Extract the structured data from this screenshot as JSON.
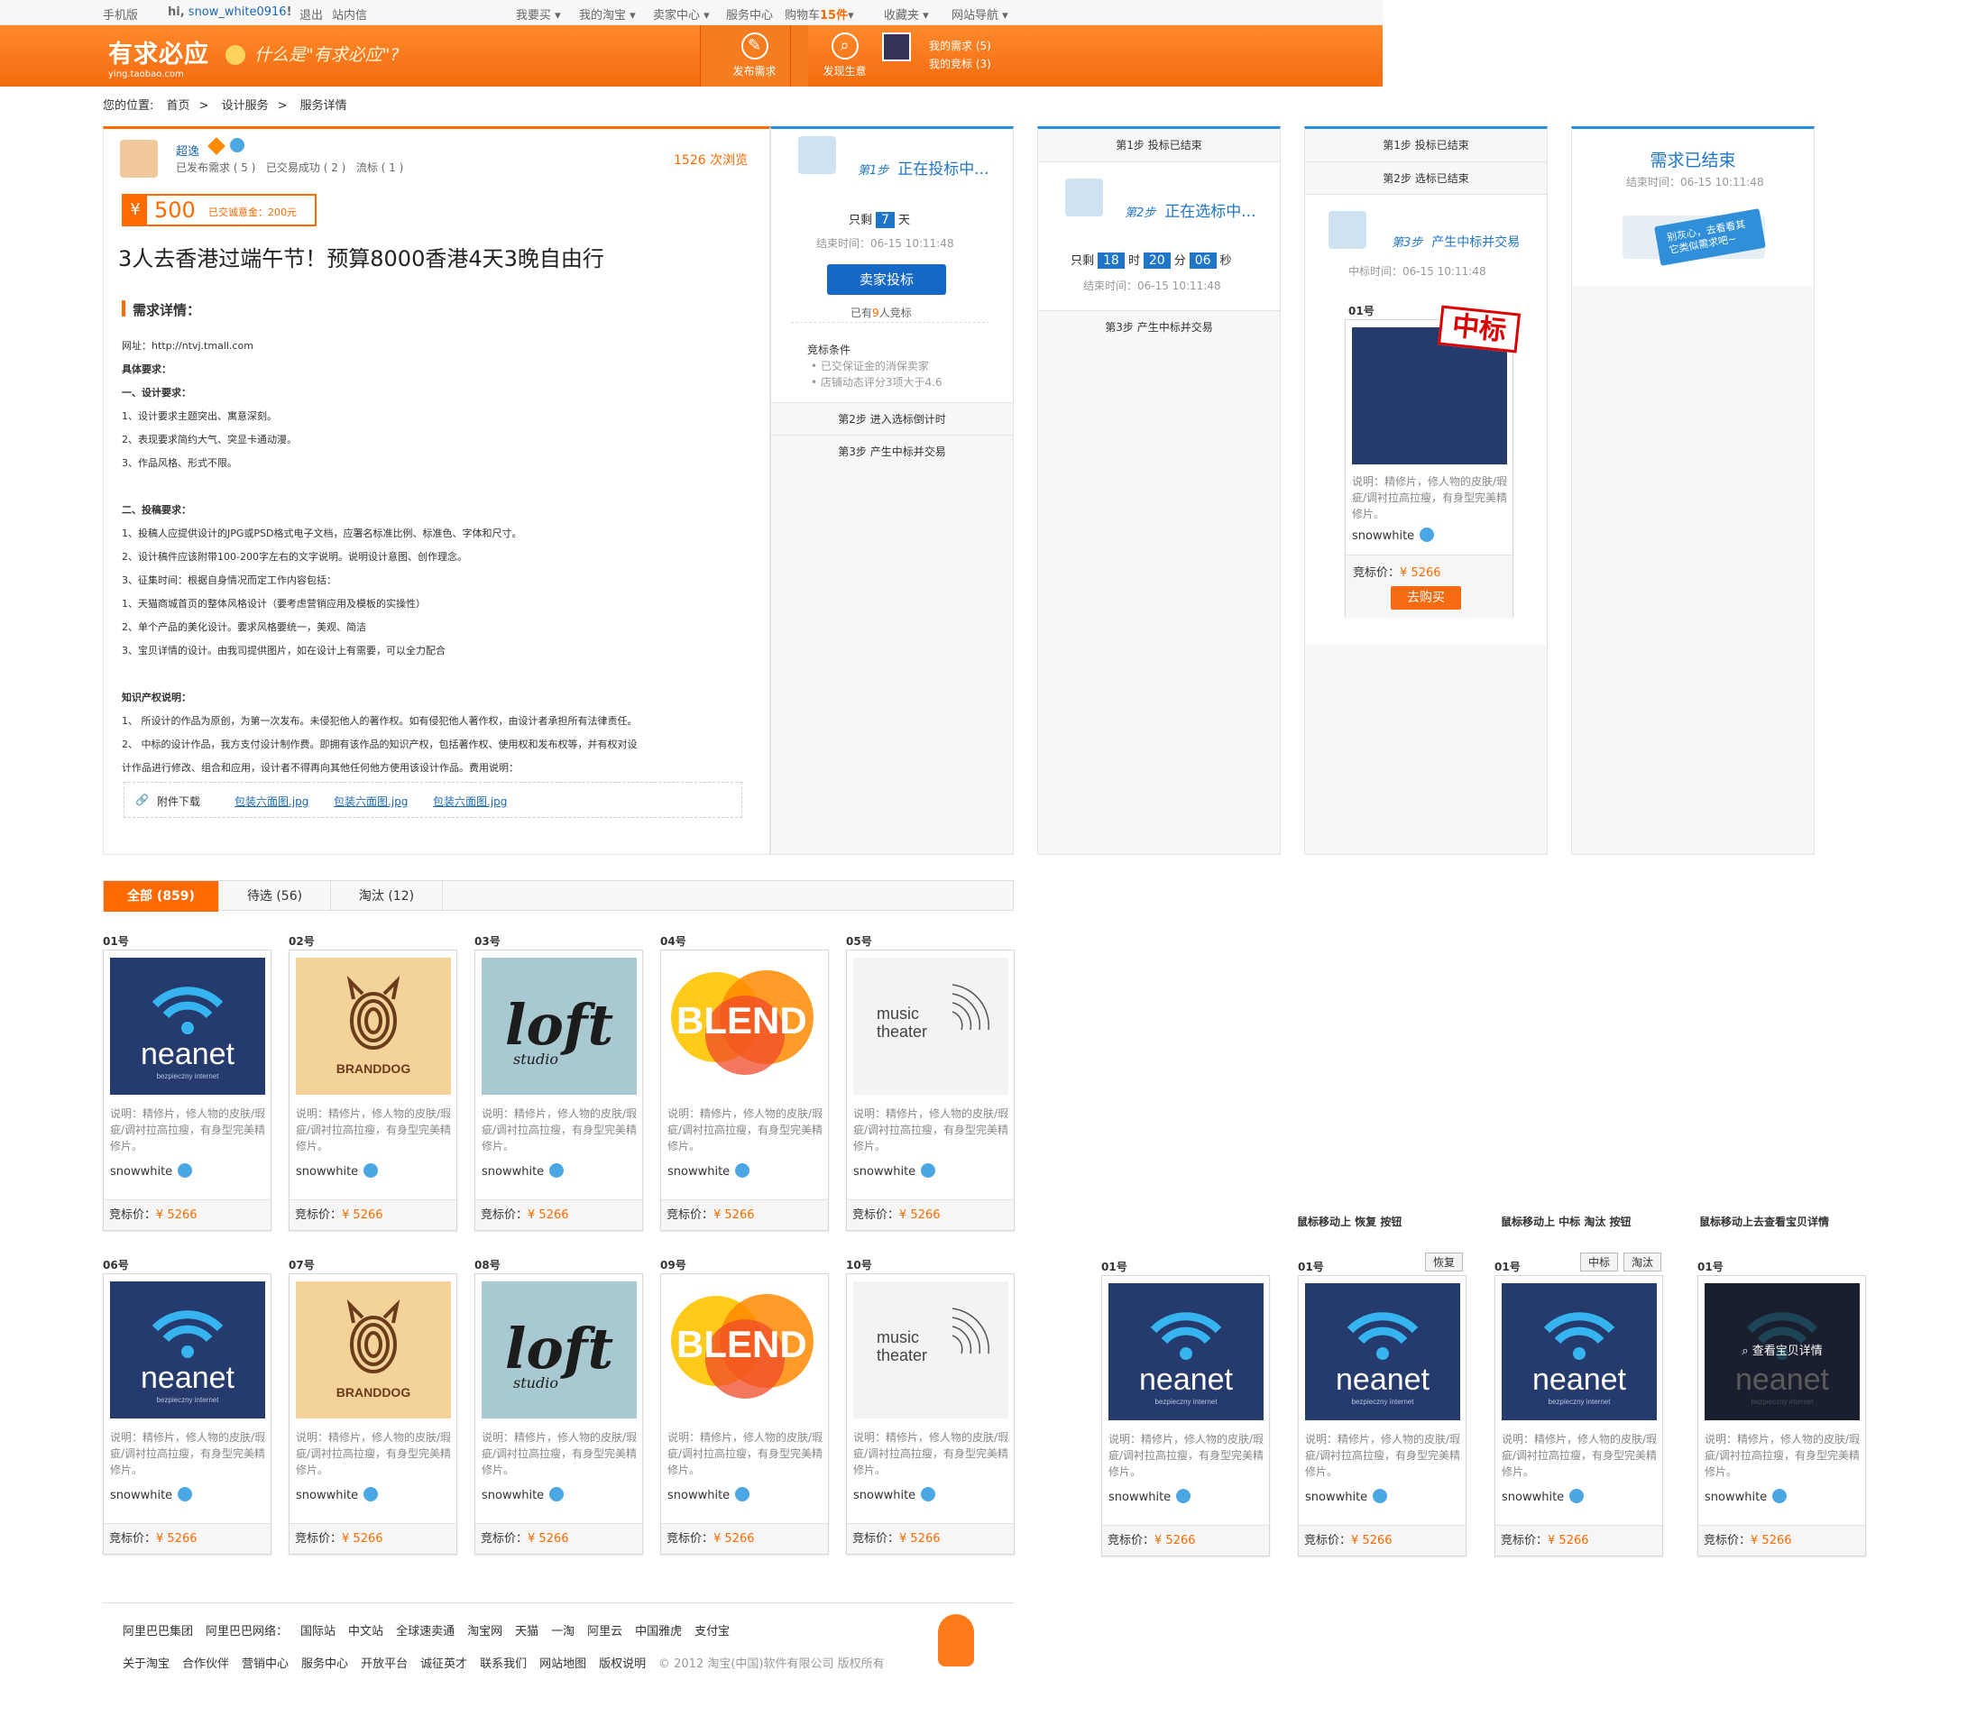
{
  "topbar": {
    "mobile": "手机版",
    "greet": "hi,",
    "username": "snow_white0916",
    "exclaim": "!",
    "logout": "退出",
    "messages": "站内信",
    "buy": "我要买 ▾",
    "mytaobao": "我的淘宝 ▾",
    "seller": "卖家中心 ▾",
    "service": "服务中心",
    "cart": "购物车",
    "cart_count": "15件",
    "cart_arrow": "▾",
    "favorites": "收藏夹 ▾",
    "sitenav": "网站导航 ▾"
  },
  "header": {
    "logo": "有求必应",
    "logo_url": "ying.taobao.com",
    "slogan": "什么是\"有求必应\"?",
    "post": "发布需求",
    "find": "发现生意",
    "my_needs": "我的需求 (5)",
    "my_bids": "我的竞标 (3)"
  },
  "crumb": {
    "label": "您的位置:",
    "home": "首页",
    "design": "设计服务",
    "detail": "服务详情",
    "sep": ">"
  },
  "post": {
    "name": "超逸",
    "views": "1526",
    "views_unit": "次浏览",
    "stats1": "已发布需求 ( 5 )",
    "stats2": "已交易成功 ( 2 )",
    "stats3": "流标 ( 1 )",
    "price": "500",
    "deposit": "已交诚意金：200元",
    "title": "3人去香港过端午节！预算8000香港4天3晚自由行",
    "section": "需求详情：",
    "lines": [
      "网址：http://ntvj.tmall.com",
      "具体要求：",
      "一、设计要求：",
      "1、设计要求主题突出、寓意深刻。",
      "2、表现要求简约大气、突显卡通动漫。",
      "3、作品风格、形式不限。",
      "",
      "二、投稿要求：",
      "1、投稿人应提供设计的JPG或PSD格式电子文档，应署名标准比例、标准色、字体和尺寸。",
      "2、设计稿件应该附带100-200字左右的文字说明。说明设计意图、创作理念。",
      "3、征集时间：根据自身情况而定工作内容包括：",
      "1、天猫商城首页的整体风格设计（要考虑营销应用及模板的实操性）",
      "2、单个产品的美化设计。要求风格要统一，美观、简洁",
      "3、宝贝详情的设计。由我司提供图片，如在设计上有需要，可以全力配合",
      "",
      "知识产权说明：",
      "1、  所设计的作品为原创，为第一次发布。未侵犯他人的著作权。如有侵犯他人著作权，由设计者承担所有法律责任。",
      "2、  中标的设计作品，我方支付设计制作费。即拥有该作品的知识产权，包括著作权、使用权和发布权等，并有权对设",
      "计作品进行修改、组合和应用，设计者不得再向其他任何他方使用该设计作品。费用说明："
    ],
    "attach_label": "附件下载",
    "attachments": [
      "包装六面图.jpg",
      "包装六面图.jpg",
      "包装六面图.jpg"
    ]
  },
  "side": {
    "step1": "第1步",
    "status": "正在投标中...",
    "remain": "只剩",
    "days": "7",
    "day_unit": "天",
    "end": "结束时间：06-15 10:11:48",
    "bid_btn": "卖家投标",
    "bidders_pre": "已有",
    "bidders": "9",
    "bidders_post": "人竞标",
    "cond_title": "竞标条件",
    "cond1": "• 已交保证金的消保卖家",
    "cond2": "• 店铺动态评分3项大于4.6",
    "step2": "第2步    进入选标倒计时",
    "step3": "第3步    产生中标并交易"
  },
  "p2": {
    "s1": "第1步    投标已结束",
    "title_em": "第2步",
    "title": "正在选标中...",
    "remain": "只剩",
    "h": "18",
    "hu": "时",
    "m": "20",
    "mu": "分",
    "s": "06",
    "su": "秒",
    "end": "结束时间：06-15 10:11:48",
    "s3": "第3步    产生中标并交易"
  },
  "p3": {
    "s1": "第1步    投标已结束",
    "s2": "第2步    选标已结束",
    "title_em": "第3步",
    "title": "产生中标并交易",
    "time": "中标时间：06-15 10:11:48",
    "no": "01号",
    "stamp": "中标",
    "desc": "说明：精修片，修人物的皮肤/瑕疵/调衬拉高拉瘦，有身型完美精修片。",
    "user": "snowwhite",
    "price_label": "竞标价：",
    "price": "¥ 5266",
    "buy": "去购买"
  },
  "p4": {
    "title": "需求已结束",
    "end": "结束时间：06-15 10:11:48",
    "banner": "别灰心，去看看其它类似需求吧~"
  },
  "tabs": {
    "all": "全部 (859)",
    "pending": "待选 (56)",
    "out": "淘汰 (12)"
  },
  "cards": [
    {
      "no": "01号",
      "kind": "neanet",
      "logo": "neanet",
      "sub": "bezpieczny internet"
    },
    {
      "no": "02号",
      "kind": "brand",
      "logo": "BRANDDOG",
      "sub": ""
    },
    {
      "no": "03号",
      "kind": "loft",
      "logo": "loft",
      "sub": "studio"
    },
    {
      "no": "04号",
      "kind": "blend",
      "logo": "BLEND",
      "sub": ""
    },
    {
      "no": "05号",
      "kind": "music",
      "logo": "music",
      "sub": "theater"
    },
    {
      "no": "06号",
      "kind": "neanet",
      "logo": "neanet",
      "sub": "bezpieczny internet"
    },
    {
      "no": "07号",
      "kind": "brand",
      "logo": "BRANDDOG",
      "sub": ""
    },
    {
      "no": "08号",
      "kind": "loft",
      "logo": "loft",
      "sub": "studio"
    },
    {
      "no": "09号",
      "kind": "blend",
      "logo": "BLEND",
      "sub": ""
    },
    {
      "no": "10号",
      "kind": "music",
      "logo": "music",
      "sub": "theater"
    }
  ],
  "card_desc": "说明：精修片，修人物的皮肤/瑕疵/调衬拉高拉瘦，有身型完美精修片。",
  "card_user": "snowwhite",
  "card_price_label": "竞标价：",
  "card_price": "¥ 5266",
  "hover": {
    "label1": "鼠标移动上  恢复  按钮",
    "label2": "鼠标移动上  中标  淘汰  按钮",
    "label3": "鼠标移动上去查看宝贝详情",
    "restore": "恢复",
    "win": "中标",
    "reject": "淘汰",
    "view": "查看宝贝详情",
    "no": "01号"
  },
  "footer": {
    "row1": [
      "阿里巴巴集团",
      "阿里巴巴网络：",
      "国际站",
      "中文站",
      "全球速卖通",
      "淘宝网",
      "天猫",
      "一淘",
      "阿里云",
      "中国雅虎",
      "支付宝"
    ],
    "row2": [
      "关于淘宝",
      "合作伙伴",
      "营销中心",
      "服务中心",
      "开放平台",
      "诚征英才",
      "联系我们",
      "网站地图",
      "版权说明"
    ],
    "copyright": "© 2012 淘宝(中国)软件有限公司 版权所有"
  },
  "colors": {
    "orange": "#ff6a00",
    "blue": "#1f76c9"
  }
}
